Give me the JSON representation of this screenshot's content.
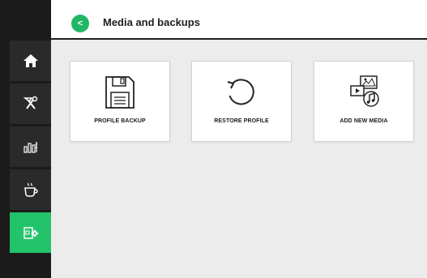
{
  "header": {
    "back_label": "<",
    "title": "Media and backups"
  },
  "sidebar": {
    "items": [
      {
        "icon": "home-icon",
        "active": false
      },
      {
        "icon": "tools-icon",
        "active": false
      },
      {
        "icon": "statistics-icon",
        "active": false
      },
      {
        "icon": "coffee-cup-icon",
        "active": false
      },
      {
        "icon": "settings-device-icon",
        "active": true
      }
    ]
  },
  "tiles": [
    {
      "label": "PROFILE BACKUP",
      "icon": "floppy-disk-icon"
    },
    {
      "label": "RESTORE PROFILE",
      "icon": "restore-arrow-icon"
    },
    {
      "label": "ADD NEW MEDIA",
      "icon": "media-icon"
    }
  ],
  "colors": {
    "accent": "#22c36b",
    "sidebar": "#1b1b1b",
    "background": "#ececec"
  }
}
